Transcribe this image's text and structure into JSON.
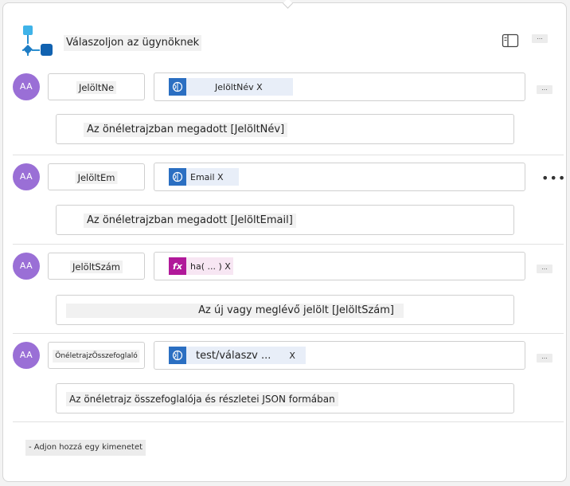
{
  "header": {
    "title": "Válaszoljon az ügynöknek",
    "more_label": "..."
  },
  "rows": [
    {
      "avatar": "AA",
      "name": "JelöltNe",
      "value_type": "variable",
      "value_text": "JelöltNév X",
      "description": "Az önéletrajzban megadott [JelöltNév]",
      "more_label": "..."
    },
    {
      "avatar": "AA",
      "name": "JelöltEm",
      "value_type": "variable",
      "value_text": "Email X",
      "description": "Az önéletrajzban megadott [JelöltEmail]",
      "more_label": "..."
    },
    {
      "avatar": "AA",
      "name": "JelöltSzám",
      "value_type": "formula",
      "value_icon_label": "fx",
      "value_text": "ha( ... ) X",
      "description": "Az új vagy meglévő jelölt [JelöltSzám]",
      "more_label": "..."
    },
    {
      "avatar": "AA",
      "name": "ÖnéletrajzÖsszefoglaló",
      "value_type": "variable",
      "value_text": "test/válaszv ...",
      "value_close": "X",
      "description": "Az önéletrajz összefoglalója és részletei JSON formában",
      "more_label": "..."
    }
  ],
  "footer": {
    "add_output_label": "- Adjon hozzá egy kimenetet"
  },
  "colors": {
    "avatar": "#9a6fd6",
    "variable_icon": "#2b6fc2",
    "formula_icon": "#b1199a"
  }
}
